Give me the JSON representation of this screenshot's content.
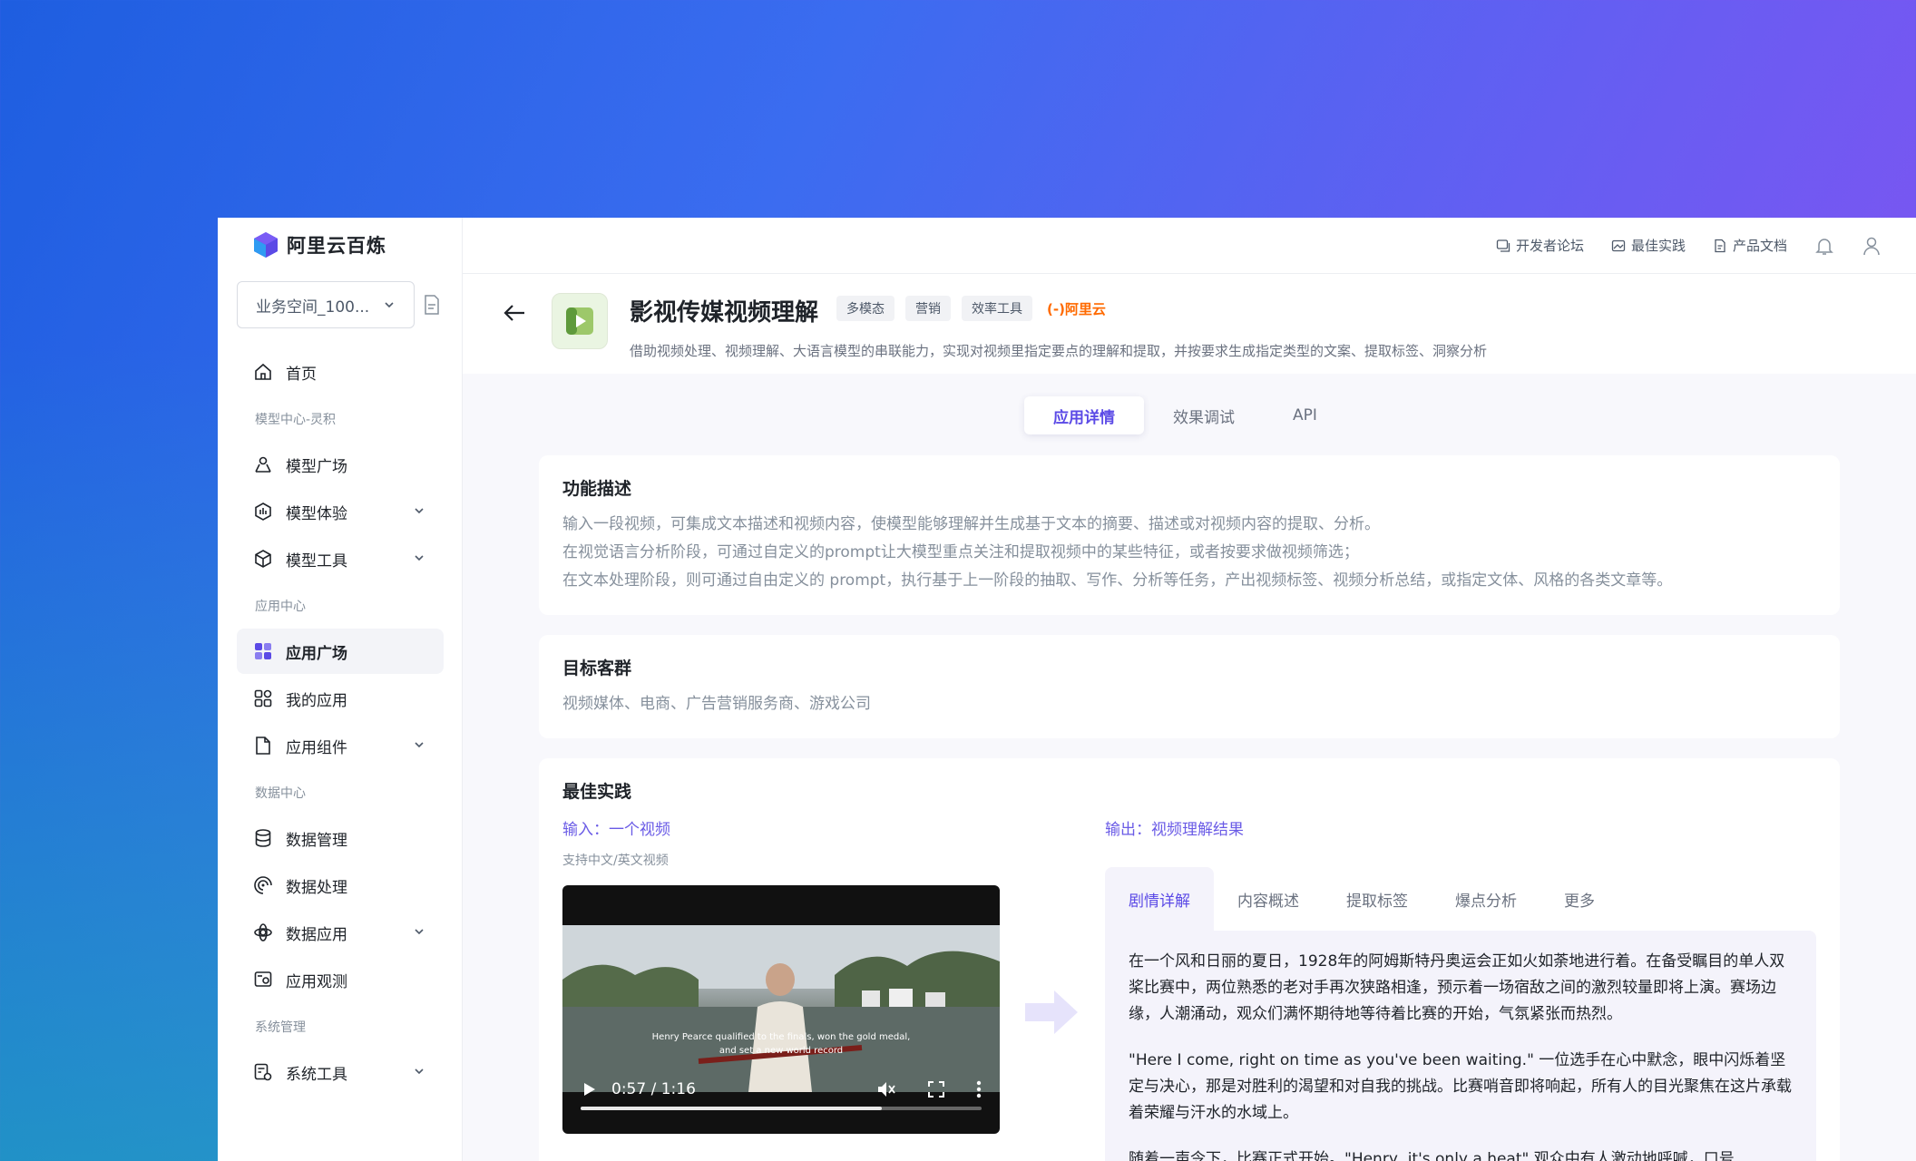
{
  "brand": {
    "name": "阿里云百炼"
  },
  "workspace": {
    "label": "业务空间_100..."
  },
  "sidebar": {
    "items": [
      {
        "type": "item",
        "label": "首页",
        "icon": "home-icon"
      },
      {
        "type": "group",
        "label": "模型中心-灵积"
      },
      {
        "type": "item",
        "label": "模型广场",
        "icon": "model-square-icon"
      },
      {
        "type": "item",
        "label": "模型体验",
        "icon": "model-experience-icon",
        "expandable": true
      },
      {
        "type": "item",
        "label": "模型工具",
        "icon": "model-tools-icon",
        "expandable": true
      },
      {
        "type": "group",
        "label": "应用中心"
      },
      {
        "type": "item",
        "label": "应用广场",
        "icon": "app-square-icon",
        "active": true
      },
      {
        "type": "item",
        "label": "我的应用",
        "icon": "my-apps-icon"
      },
      {
        "type": "item",
        "label": "应用组件",
        "icon": "app-components-icon",
        "expandable": true
      },
      {
        "type": "group",
        "label": "数据中心"
      },
      {
        "type": "item",
        "label": "数据管理",
        "icon": "database-icon"
      },
      {
        "type": "item",
        "label": "数据处理",
        "icon": "data-processing-icon"
      },
      {
        "type": "item",
        "label": "数据应用",
        "icon": "data-app-icon",
        "expandable": true
      },
      {
        "type": "item",
        "label": "应用观测",
        "icon": "observability-icon"
      },
      {
        "type": "group",
        "label": "系统管理"
      },
      {
        "type": "item",
        "label": "系统工具",
        "icon": "system-tools-icon",
        "expandable": true
      }
    ]
  },
  "topbar": {
    "forum": "开发者论坛",
    "best_practice": "最佳实践",
    "docs": "产品文档"
  },
  "app": {
    "title": "影视传媒视频理解",
    "tags": [
      "多模态",
      "营销",
      "效率工具"
    ],
    "vendor_tag": "(-)阿里云",
    "description": "借助视频处理、视频理解、大语言模型的串联能力，实现对视频里指定要点的理解和提取，并按要求生成指定类型的文案、提取标签、洞察分析"
  },
  "tabs": [
    "应用详情",
    "效果调试",
    "API"
  ],
  "feature": {
    "title": "功能描述",
    "lines": [
      "输入一段视频，可集成文本描述和视频内容，使模型能够理解并生成基于文本的摘要、描述或对视频内容的提取、分析。",
      "在视觉语言分析阶段，可通过自定义的prompt让大模型重点关注和提取视频中的某些特征，或者按要求做视频筛选；",
      "在文本处理阶段，则可通过自由定义的 prompt，执行基于上一阶段的抽取、写作、分析等任务，产出视频标签、视频分析总结，或指定文体、风格的各类文章等。"
    ]
  },
  "audience": {
    "title": "目标客群",
    "text": "视频媒体、电商、广告营销服务商、游戏公司"
  },
  "practice": {
    "title": "最佳实践",
    "input_label": "输入：一个视频",
    "input_note": "支持中文/英文视频",
    "output_label": "输出：视频理解结果",
    "video": {
      "caption_line1": "Henry Pearce qualified to the finals, won the gold medal,",
      "caption_line2": "and set a new world record",
      "time": "0:57 / 1:16",
      "progress": 0.75
    },
    "output_tabs": [
      "剧情详解",
      "内容概述",
      "提取标签",
      "爆点分析",
      "更多"
    ],
    "output_paragraphs": [
      "在一个风和日丽的夏日，1928年的阿姆斯特丹奥运会正如火如荼地进行着。在备受瞩目的单人双桨比赛中，两位熟悉的老对手再次狭路相逢，预示着一场宿敌之间的激烈较量即将上演。赛场边缘，人潮涌动，观众们满怀期待地等待着比赛的开始，气氛紧张而热烈。",
      "\"Here I come, right on time as you've been waiting.\" 一位选手在心中默念，眼中闪烁着坚定与决心，那是对胜利的渴望和对自我的挑战。比赛哨音即将响起，所有人的目光聚焦在这片承载着荣耀与汗水的水域上。",
      "随着一声令下，比赛正式开始。\"Henry, it's only a heat\" 观众中有人激动地呼喊，口号"
    ]
  },
  "colors": {
    "accent": "#5b4ae6",
    "brand_orange": "#ff6a00"
  }
}
